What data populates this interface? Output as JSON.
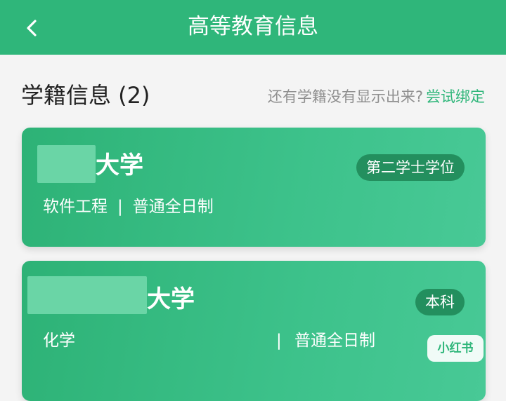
{
  "header": {
    "title": "高等教育信息"
  },
  "section": {
    "title": "学籍信息 (2)",
    "hint": "还有学籍没有显示出来?",
    "link": "尝试绑定"
  },
  "cards": [
    {
      "university": "大学",
      "badge": "第二学士学位",
      "major": "软件工程",
      "separator": "|",
      "mode": "普通全日制"
    },
    {
      "university": "大学",
      "badge": "本科",
      "major": "化学",
      "separator": "|",
      "mode": "普通全日制"
    }
  ],
  "watermark": {
    "text": "小红书"
  },
  "colors": {
    "accent": "#2fb67a",
    "badge_bg": "#238f5e"
  },
  "icons": {
    "back": "chevron-left-icon"
  }
}
